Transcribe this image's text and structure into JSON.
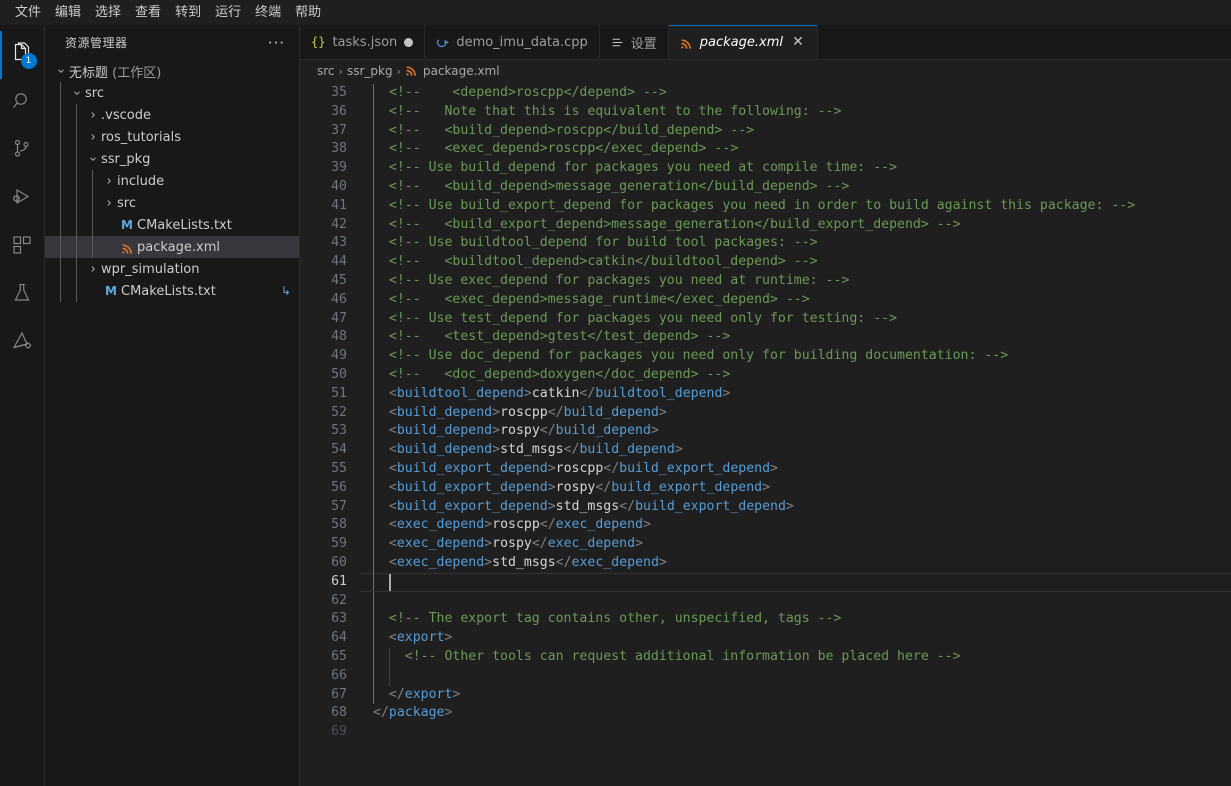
{
  "menubar": {
    "items": [
      "文件",
      "编辑",
      "选择",
      "查看",
      "转到",
      "运行",
      "终端",
      "帮助"
    ]
  },
  "activitybar": {
    "items": [
      {
        "name": "explorer",
        "icon": "files-icon",
        "badge": "1",
        "active": true
      },
      {
        "name": "search",
        "icon": "search-icon",
        "badge": "",
        "active": false
      },
      {
        "name": "source-control",
        "icon": "source-control-icon",
        "badge": "",
        "active": false
      },
      {
        "name": "run-debug",
        "icon": "run-and-debug-icon",
        "badge": "",
        "active": false
      },
      {
        "name": "extensions",
        "icon": "extensions-icon",
        "badge": "",
        "active": false
      },
      {
        "name": "testing",
        "icon": "beaker-icon",
        "badge": "",
        "active": false
      },
      {
        "name": "ros",
        "icon": "ros-icon",
        "badge": "",
        "active": false
      }
    ]
  },
  "sidebar": {
    "title": "资源管理器",
    "more_actions": "···",
    "tree": [
      {
        "label": "无标题",
        "suffix": " (工作区)",
        "indent": 0,
        "twisty": "down",
        "icon": "",
        "selected": false,
        "symlink": ""
      },
      {
        "label": "src",
        "suffix": "",
        "indent": 1,
        "twisty": "down",
        "icon": "",
        "selected": false,
        "symlink": ""
      },
      {
        "label": ".vscode",
        "suffix": "",
        "indent": 2,
        "twisty": "right",
        "icon": "",
        "selected": false,
        "symlink": ""
      },
      {
        "label": "ros_tutorials",
        "suffix": "",
        "indent": 2,
        "twisty": "right",
        "icon": "",
        "selected": false,
        "symlink": ""
      },
      {
        "label": "ssr_pkg",
        "suffix": "",
        "indent": 2,
        "twisty": "down",
        "icon": "",
        "selected": false,
        "symlink": ""
      },
      {
        "label": "include",
        "suffix": "",
        "indent": 3,
        "twisty": "right",
        "icon": "",
        "selected": false,
        "symlink": ""
      },
      {
        "label": "src",
        "suffix": "",
        "indent": 3,
        "twisty": "right",
        "icon": "",
        "selected": false,
        "symlink": ""
      },
      {
        "label": "CMakeLists.txt",
        "suffix": "",
        "indent": 3,
        "twisty": "none",
        "icon": "markdown-file-icon",
        "selected": false,
        "symlink": ""
      },
      {
        "label": "package.xml",
        "suffix": "",
        "indent": 3,
        "twisty": "none",
        "icon": "xml-file-icon",
        "selected": true,
        "symlink": ""
      },
      {
        "label": "wpr_simulation",
        "suffix": "",
        "indent": 2,
        "twisty": "right",
        "icon": "",
        "selected": false,
        "symlink": ""
      },
      {
        "label": "CMakeLists.txt",
        "suffix": "",
        "indent": 2,
        "twisty": "none",
        "icon": "markdown-file-icon",
        "selected": false,
        "symlink": "↳"
      }
    ]
  },
  "tabs": [
    {
      "label": "tasks.json",
      "icon": "json-icon",
      "state": "dirty",
      "active": false
    },
    {
      "label": "demo_imu_data.cpp",
      "icon": "cpp-icon",
      "state": "",
      "active": false
    },
    {
      "label": "设置",
      "icon": "settings-icon",
      "state": "",
      "active": false
    },
    {
      "label": "package.xml",
      "icon": "xml-icon",
      "state": "close",
      "active": true
    }
  ],
  "breadcrumbs": {
    "items": [
      "src",
      "ssr_pkg",
      "package.xml"
    ],
    "separator": "›",
    "file_icon": "xml-icon"
  },
  "editor": {
    "language": "xml",
    "cursor_line": 61,
    "first_visible_line": 35,
    "last_visible_line": 69,
    "lines": [
      {
        "n": 35,
        "indent": 1,
        "tokens": [
          {
            "t": "cm",
            "v": "  <!--    <depend>roscpp</depend> -->"
          }
        ]
      },
      {
        "n": 36,
        "indent": 1,
        "tokens": [
          {
            "t": "cm",
            "v": "  <!--   Note that this is equivalent to the following: -->"
          }
        ]
      },
      {
        "n": 37,
        "indent": 1,
        "tokens": [
          {
            "t": "cm",
            "v": "  <!--   <build_depend>roscpp</build_depend> -->"
          }
        ]
      },
      {
        "n": 38,
        "indent": 1,
        "tokens": [
          {
            "t": "cm",
            "v": "  <!--   <exec_depend>roscpp</exec_depend> -->"
          }
        ]
      },
      {
        "n": 39,
        "indent": 1,
        "tokens": [
          {
            "t": "cm",
            "v": "  <!-- Use build_depend for packages you need at compile time: -->"
          }
        ]
      },
      {
        "n": 40,
        "indent": 1,
        "tokens": [
          {
            "t": "cm",
            "v": "  <!--   <build_depend>message_generation</build_depend> -->"
          }
        ]
      },
      {
        "n": 41,
        "indent": 1,
        "tokens": [
          {
            "t": "cm",
            "v": "  <!-- Use build_export_depend for packages you need in order to build against this package: -->"
          }
        ]
      },
      {
        "n": 42,
        "indent": 1,
        "tokens": [
          {
            "t": "cm",
            "v": "  <!--   <build_export_depend>message_generation</build_export_depend> -->"
          }
        ]
      },
      {
        "n": 43,
        "indent": 1,
        "tokens": [
          {
            "t": "cm",
            "v": "  <!-- Use buildtool_depend for build tool packages: -->"
          }
        ]
      },
      {
        "n": 44,
        "indent": 1,
        "tokens": [
          {
            "t": "cm",
            "v": "  <!--   <buildtool_depend>catkin</buildtool_depend> -->"
          }
        ]
      },
      {
        "n": 45,
        "indent": 1,
        "tokens": [
          {
            "t": "cm",
            "v": "  <!-- Use exec_depend for packages you need at runtime: -->"
          }
        ]
      },
      {
        "n": 46,
        "indent": 1,
        "tokens": [
          {
            "t": "cm",
            "v": "  <!--   <exec_depend>message_runtime</exec_depend> -->"
          }
        ]
      },
      {
        "n": 47,
        "indent": 1,
        "tokens": [
          {
            "t": "cm",
            "v": "  <!-- Use test_depend for packages you need only for testing: -->"
          }
        ]
      },
      {
        "n": 48,
        "indent": 1,
        "tokens": [
          {
            "t": "cm",
            "v": "  <!--   <test_depend>gtest</test_depend> -->"
          }
        ]
      },
      {
        "n": 49,
        "indent": 1,
        "tokens": [
          {
            "t": "cm",
            "v": "  <!-- Use doc_depend for packages you need only for building documentation: -->"
          }
        ]
      },
      {
        "n": 50,
        "indent": 1,
        "tokens": [
          {
            "t": "cm",
            "v": "  <!--   <doc_depend>doxygen</doc_depend> -->"
          }
        ]
      },
      {
        "n": 51,
        "indent": 1,
        "tokens": [
          {
            "t": "pu",
            "v": "  <"
          },
          {
            "t": "tg",
            "v": "buildtool_depend"
          },
          {
            "t": "pu",
            "v": ">"
          },
          {
            "t": "tx",
            "v": "catkin"
          },
          {
            "t": "pu",
            "v": "</"
          },
          {
            "t": "tg",
            "v": "buildtool_depend"
          },
          {
            "t": "pu",
            "v": ">"
          }
        ]
      },
      {
        "n": 52,
        "indent": 1,
        "tokens": [
          {
            "t": "pu",
            "v": "  <"
          },
          {
            "t": "tg",
            "v": "build_depend"
          },
          {
            "t": "pu",
            "v": ">"
          },
          {
            "t": "tx",
            "v": "roscpp"
          },
          {
            "t": "pu",
            "v": "</"
          },
          {
            "t": "tg",
            "v": "build_depend"
          },
          {
            "t": "pu",
            "v": ">"
          }
        ]
      },
      {
        "n": 53,
        "indent": 1,
        "tokens": [
          {
            "t": "pu",
            "v": "  <"
          },
          {
            "t": "tg",
            "v": "build_depend"
          },
          {
            "t": "pu",
            "v": ">"
          },
          {
            "t": "tx",
            "v": "rospy"
          },
          {
            "t": "pu",
            "v": "</"
          },
          {
            "t": "tg",
            "v": "build_depend"
          },
          {
            "t": "pu",
            "v": ">"
          }
        ]
      },
      {
        "n": 54,
        "indent": 1,
        "tokens": [
          {
            "t": "pu",
            "v": "  <"
          },
          {
            "t": "tg",
            "v": "build_depend"
          },
          {
            "t": "pu",
            "v": ">"
          },
          {
            "t": "tx",
            "v": "std_msgs"
          },
          {
            "t": "pu",
            "v": "</"
          },
          {
            "t": "tg",
            "v": "build_depend"
          },
          {
            "t": "pu",
            "v": ">"
          }
        ]
      },
      {
        "n": 55,
        "indent": 1,
        "tokens": [
          {
            "t": "pu",
            "v": "  <"
          },
          {
            "t": "tg",
            "v": "build_export_depend"
          },
          {
            "t": "pu",
            "v": ">"
          },
          {
            "t": "tx",
            "v": "roscpp"
          },
          {
            "t": "pu",
            "v": "</"
          },
          {
            "t": "tg",
            "v": "build_export_depend"
          },
          {
            "t": "pu",
            "v": ">"
          }
        ]
      },
      {
        "n": 56,
        "indent": 1,
        "tokens": [
          {
            "t": "pu",
            "v": "  <"
          },
          {
            "t": "tg",
            "v": "build_export_depend"
          },
          {
            "t": "pu",
            "v": ">"
          },
          {
            "t": "tx",
            "v": "rospy"
          },
          {
            "t": "pu",
            "v": "</"
          },
          {
            "t": "tg",
            "v": "build_export_depend"
          },
          {
            "t": "pu",
            "v": ">"
          }
        ]
      },
      {
        "n": 57,
        "indent": 1,
        "tokens": [
          {
            "t": "pu",
            "v": "  <"
          },
          {
            "t": "tg",
            "v": "build_export_depend"
          },
          {
            "t": "pu",
            "v": ">"
          },
          {
            "t": "tx",
            "v": "std_msgs"
          },
          {
            "t": "pu",
            "v": "</"
          },
          {
            "t": "tg",
            "v": "build_export_depend"
          },
          {
            "t": "pu",
            "v": ">"
          }
        ]
      },
      {
        "n": 58,
        "indent": 1,
        "tokens": [
          {
            "t": "pu",
            "v": "  <"
          },
          {
            "t": "tg",
            "v": "exec_depend"
          },
          {
            "t": "pu",
            "v": ">"
          },
          {
            "t": "tx",
            "v": "roscpp"
          },
          {
            "t": "pu",
            "v": "</"
          },
          {
            "t": "tg",
            "v": "exec_depend"
          },
          {
            "t": "pu",
            "v": ">"
          }
        ]
      },
      {
        "n": 59,
        "indent": 1,
        "tokens": [
          {
            "t": "pu",
            "v": "  <"
          },
          {
            "t": "tg",
            "v": "exec_depend"
          },
          {
            "t": "pu",
            "v": ">"
          },
          {
            "t": "tx",
            "v": "rospy"
          },
          {
            "t": "pu",
            "v": "</"
          },
          {
            "t": "tg",
            "v": "exec_depend"
          },
          {
            "t": "pu",
            "v": ">"
          }
        ]
      },
      {
        "n": 60,
        "indent": 1,
        "tokens": [
          {
            "t": "pu",
            "v": "  <"
          },
          {
            "t": "tg",
            "v": "exec_depend"
          },
          {
            "t": "pu",
            "v": ">"
          },
          {
            "t": "tx",
            "v": "std_msgs"
          },
          {
            "t": "pu",
            "v": "</"
          },
          {
            "t": "tg",
            "v": "exec_depend"
          },
          {
            "t": "pu",
            "v": ">"
          }
        ]
      },
      {
        "n": 61,
        "indent": 1,
        "tokens": [],
        "current": true
      },
      {
        "n": 62,
        "indent": 1,
        "tokens": []
      },
      {
        "n": 63,
        "indent": 1,
        "tokens": [
          {
            "t": "cm",
            "v": "  <!-- The export tag contains other, unspecified, tags -->"
          }
        ]
      },
      {
        "n": 64,
        "indent": 1,
        "tokens": [
          {
            "t": "pu",
            "v": "  <"
          },
          {
            "t": "tg",
            "v": "export"
          },
          {
            "t": "pu",
            "v": ">"
          }
        ]
      },
      {
        "n": 65,
        "indent": 2,
        "tokens": [
          {
            "t": "cm",
            "v": "    <!-- Other tools can request additional information be placed here -->"
          }
        ]
      },
      {
        "n": 66,
        "indent": 2,
        "tokens": []
      },
      {
        "n": 67,
        "indent": 1,
        "tokens": [
          {
            "t": "pu",
            "v": "  </"
          },
          {
            "t": "tg",
            "v": "export"
          },
          {
            "t": "pu",
            "v": ">"
          }
        ]
      },
      {
        "n": 68,
        "indent": 0,
        "tokens": [
          {
            "t": "pu",
            "v": "</"
          },
          {
            "t": "tg",
            "v": "package"
          },
          {
            "t": "pu",
            "v": ">"
          }
        ]
      },
      {
        "n": 69,
        "indent": 0,
        "tokens": [],
        "faint": true
      }
    ]
  },
  "colors": {
    "accent": "#0078D4",
    "editor_bg": "#1F1F1F",
    "sidebar_bg": "#181818",
    "comment": "#6A9955",
    "tag": "#569CD6",
    "text": "#D4D4D4",
    "punctuation": "#808080",
    "selection": "#37373D",
    "xml_icon": "#D9732B",
    "md_icon": "#5EA9DD",
    "json_icon": "#CBCB41"
  }
}
